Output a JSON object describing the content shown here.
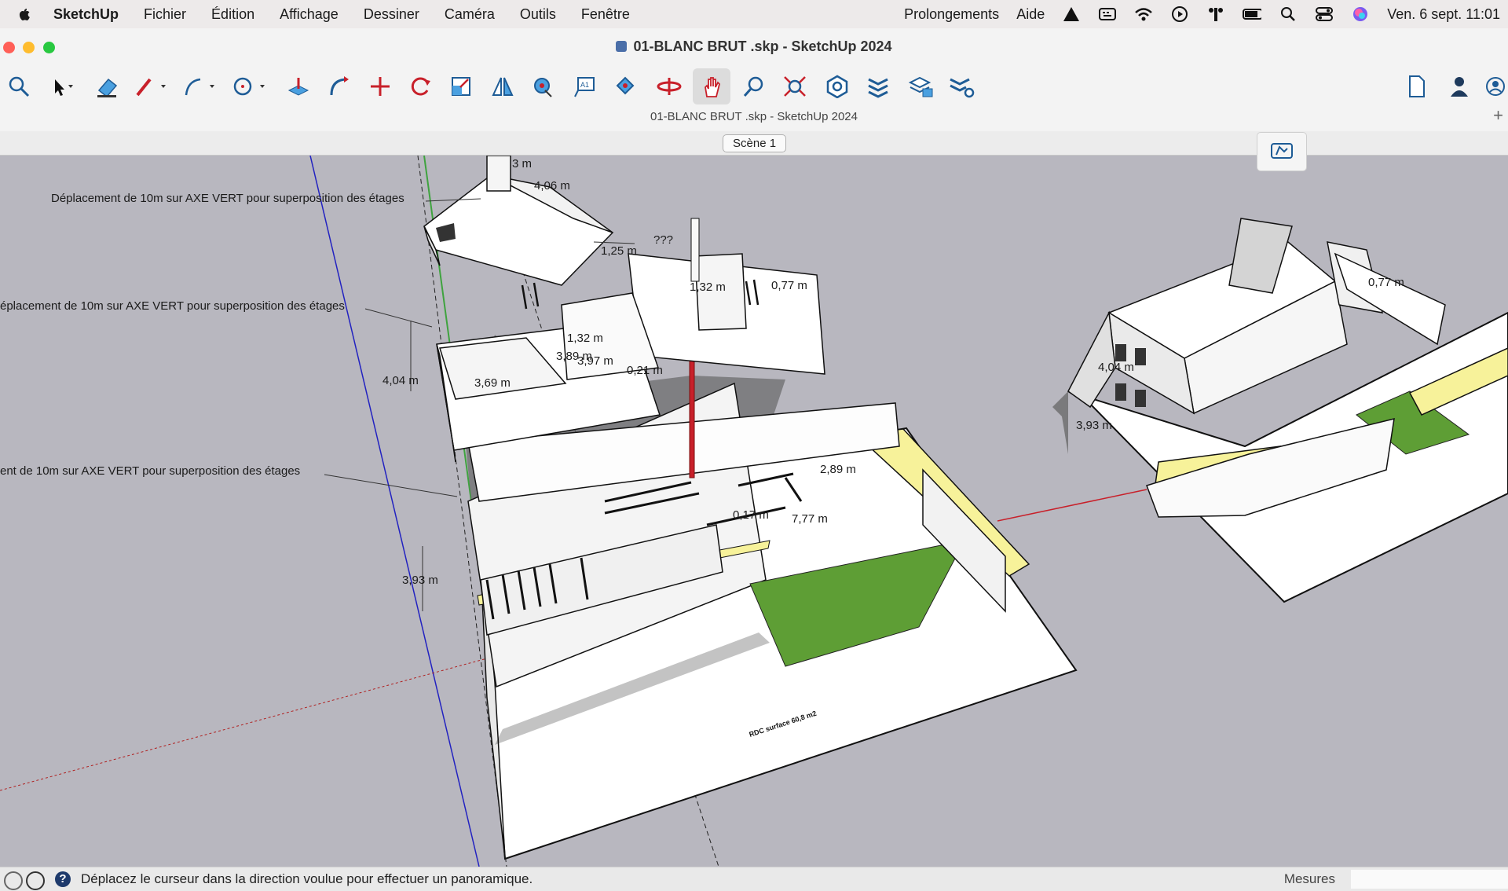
{
  "menubar": {
    "app_name": "SketchUp",
    "items": [
      "Fichier",
      "Édition",
      "Affichage",
      "Dessiner",
      "Caméra",
      "Outils",
      "Fenêtre"
    ],
    "right_items": [
      "Prolongements",
      "Aide"
    ],
    "clock": "Ven. 6 sept.  11:01"
  },
  "window": {
    "title": "01-BLANC BRUT .skp - SketchUp 2024",
    "document_title": "01-BLANC BRUT .skp - SketchUp 2024"
  },
  "toolbar": {
    "tools": [
      "search-tool",
      "select-tool",
      "eraser-tool",
      "line-tool",
      "arc-tool",
      "circle-tool",
      "push-pull-tool",
      "follow-me-tool",
      "move-tool",
      "rotate-tool",
      "scale-tool",
      "flip-tool",
      "tape-measure-tool",
      "text-tool",
      "paint-bucket-tool",
      "orbit-tool",
      "pan-tool",
      "zoom-tool",
      "zoom-extents-tool",
      "components-tool",
      "tags-tool",
      "layers-tool",
      "scenes-tool",
      "new-file-tool",
      "account-tool",
      "profile-tool"
    ],
    "active_tool": "pan-tool"
  },
  "scenes": {
    "tab": "Scène 1"
  },
  "model": {
    "annotation_1": "Déplacement de 10m  sur AXE VERT pour superposition des étages",
    "annotation_2": "éplacement de 10m  sur AXE VERT pour superposition des étages",
    "annotation_3": "ent de 10m  sur AXE VERT pour superposition des étages",
    "dimensions": {
      "roof_a": "4,06 m",
      "roof_b": "1,25 m",
      "roof_q": "???",
      "roof_top": "3 m",
      "f1_height": "4,04 m",
      "f1_a": "3,69 m",
      "f1_b": "3,97 m",
      "f1_c": "3,89 m",
      "f1_d": "1,32 m",
      "f1_e": "0,21 m",
      "f1_f": "1,32 m",
      "f1_g": "0,77 m",
      "gf_height": "3,93 m",
      "gf_a": "2,89 m",
      "gf_b": "0,17 m",
      "gf_c": "7,77 m",
      "right_a": "4,04 m",
      "right_b": "3,93 m",
      "right_c": "0,77 m"
    },
    "floor_label": "RDC surface 60,8 m2"
  },
  "statusbar": {
    "message": "Déplacez le curseur dans la direction voulue pour effectuer un panoramique.",
    "measures_label": "Mesures"
  },
  "colors": {
    "viewport_bg": "#b8b7bf",
    "wall": "#ffffff",
    "shadow": "#6c6c6e",
    "grass": "#5e9e35",
    "yellow_edge": "#f7f29a",
    "red_axis": "#c8202a",
    "green_axis": "#3fa33f",
    "blue_axis": "#2222c0"
  }
}
